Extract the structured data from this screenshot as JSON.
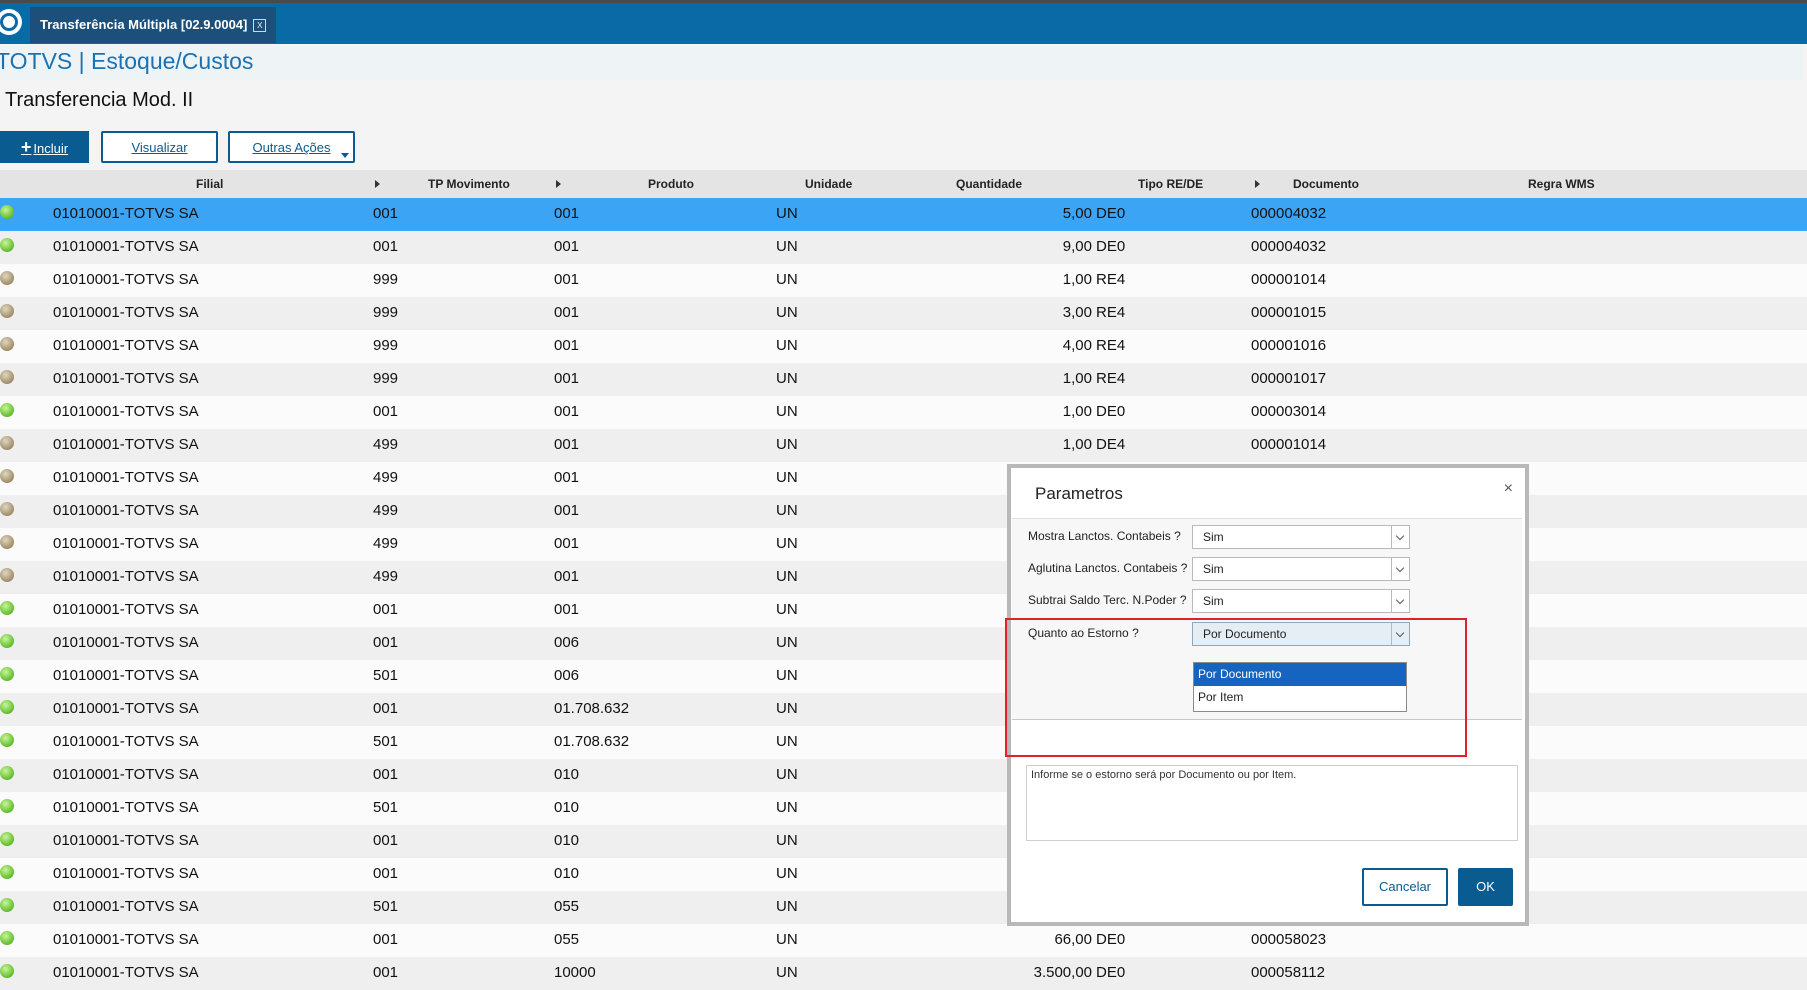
{
  "window": {
    "tab_title": "Transferência Múltipla [02.9.0004]",
    "tab_close": "x",
    "app_title": "TOTVS | Estoque/Custos",
    "page_title": "Transferencia Mod. II"
  },
  "toolbar": {
    "incluir": "Incluir",
    "visualizar": "Visualizar",
    "outras": "Outras Ações"
  },
  "grid": {
    "headers": {
      "filial": "Filial",
      "tp": "TP Movimento",
      "produto": "Produto",
      "unidade": "Unidade",
      "quantidade": "Quantidade",
      "tipo": "Tipo RE/DE",
      "documento": "Documento",
      "regra": "Regra WMS"
    },
    "rows": [
      {
        "status": "green",
        "filial": "01010001-TOTVS SA",
        "tp": "001",
        "produto": "001",
        "un": "UN",
        "qtd": "5,00",
        "tipo": "DE0",
        "doc": "000004032"
      },
      {
        "status": "green",
        "filial": "01010001-TOTVS SA",
        "tp": "001",
        "produto": "001",
        "un": "UN",
        "qtd": "9,00",
        "tipo": "DE0",
        "doc": "000004032"
      },
      {
        "status": "brown",
        "filial": "01010001-TOTVS SA",
        "tp": "999",
        "produto": "001",
        "un": "UN",
        "qtd": "1,00",
        "tipo": "RE4",
        "doc": "000001014"
      },
      {
        "status": "brown",
        "filial": "01010001-TOTVS SA",
        "tp": "999",
        "produto": "001",
        "un": "UN",
        "qtd": "3,00",
        "tipo": "RE4",
        "doc": "000001015"
      },
      {
        "status": "brown",
        "filial": "01010001-TOTVS SA",
        "tp": "999",
        "produto": "001",
        "un": "UN",
        "qtd": "4,00",
        "tipo": "RE4",
        "doc": "000001016"
      },
      {
        "status": "brown",
        "filial": "01010001-TOTVS SA",
        "tp": "999",
        "produto": "001",
        "un": "UN",
        "qtd": "1,00",
        "tipo": "RE4",
        "doc": "000001017"
      },
      {
        "status": "green",
        "filial": "01010001-TOTVS SA",
        "tp": "001",
        "produto": "001",
        "un": "UN",
        "qtd": "1,00",
        "tipo": "DE0",
        "doc": "000003014"
      },
      {
        "status": "brown",
        "filial": "01010001-TOTVS SA",
        "tp": "499",
        "produto": "001",
        "un": "UN",
        "qtd": "1,00",
        "tipo": "DE4",
        "doc": "000001014"
      },
      {
        "status": "brown",
        "filial": "01010001-TOTVS SA",
        "tp": "499",
        "produto": "001",
        "un": "UN",
        "qtd": "",
        "tipo": "",
        "doc": ""
      },
      {
        "status": "brown",
        "filial": "01010001-TOTVS SA",
        "tp": "499",
        "produto": "001",
        "un": "UN",
        "qtd": "",
        "tipo": "",
        "doc": ""
      },
      {
        "status": "brown",
        "filial": "01010001-TOTVS SA",
        "tp": "499",
        "produto": "001",
        "un": "UN",
        "qtd": "",
        "tipo": "",
        "doc": ""
      },
      {
        "status": "brown",
        "filial": "01010001-TOTVS SA",
        "tp": "499",
        "produto": "001",
        "un": "UN",
        "qtd": "",
        "tipo": "",
        "doc": ""
      },
      {
        "status": "green",
        "filial": "01010001-TOTVS SA",
        "tp": "001",
        "produto": "001",
        "un": "UN",
        "qtd": "",
        "tipo": "",
        "doc": ""
      },
      {
        "status": "green",
        "filial": "01010001-TOTVS SA",
        "tp": "001",
        "produto": "006",
        "un": "UN",
        "qtd": "",
        "tipo": "",
        "doc": ""
      },
      {
        "status": "green",
        "filial": "01010001-TOTVS SA",
        "tp": "501",
        "produto": "006",
        "un": "UN",
        "qtd": "",
        "tipo": "",
        "doc": ""
      },
      {
        "status": "green",
        "filial": "01010001-TOTVS SA",
        "tp": "001",
        "produto": "01.708.632",
        "un": "UN",
        "qtd": "",
        "tipo": "",
        "doc": ""
      },
      {
        "status": "green",
        "filial": "01010001-TOTVS SA",
        "tp": "501",
        "produto": "01.708.632",
        "un": "UN",
        "qtd": "",
        "tipo": "",
        "doc": ""
      },
      {
        "status": "green",
        "filial": "01010001-TOTVS SA",
        "tp": "001",
        "produto": "010",
        "un": "UN",
        "qtd": "",
        "tipo": "",
        "doc": ""
      },
      {
        "status": "green",
        "filial": "01010001-TOTVS SA",
        "tp": "501",
        "produto": "010",
        "un": "UN",
        "qtd": "",
        "tipo": "",
        "doc": ""
      },
      {
        "status": "green",
        "filial": "01010001-TOTVS SA",
        "tp": "001",
        "produto": "010",
        "un": "UN",
        "qtd": "",
        "tipo": "",
        "doc": ""
      },
      {
        "status": "green",
        "filial": "01010001-TOTVS SA",
        "tp": "001",
        "produto": "010",
        "un": "UN",
        "qtd": "",
        "tipo": "",
        "doc": ""
      },
      {
        "status": "green",
        "filial": "01010001-TOTVS SA",
        "tp": "501",
        "produto": "055",
        "un": "UN",
        "qtd": "",
        "tipo": "",
        "doc": ""
      },
      {
        "status": "green",
        "filial": "01010001-TOTVS SA",
        "tp": "001",
        "produto": "055",
        "un": "UN",
        "qtd": "66,00",
        "tipo": "DE0",
        "doc": "000058023"
      },
      {
        "status": "green",
        "filial": "01010001-TOTVS SA",
        "tp": "001",
        "produto": "10000",
        "un": "UN",
        "qtd": "3.500,00",
        "tipo": "DE0",
        "doc": "000058112"
      }
    ]
  },
  "modal": {
    "title": "Parametros",
    "close": "×",
    "params": [
      {
        "label": "Mostra Lanctos. Contabeis ?",
        "value": "Sim"
      },
      {
        "label": "Aglutina Lanctos. Contabeis ?",
        "value": "Sim"
      },
      {
        "label": "Subtrai Saldo Terc. N.Poder ?",
        "value": "Sim"
      },
      {
        "label": "Quanto ao Estorno ?",
        "value": "Por Documento"
      }
    ],
    "options": [
      "Por Documento",
      "Por Item"
    ],
    "help": "Informe se o estorno será por Documento ou por Item.",
    "cancel": "Cancelar",
    "ok": "OK"
  },
  "colors": {
    "header_bar": "#0a6aa6",
    "primary": "#0a5b8f",
    "selected_row": "#3ba4f4",
    "highlight_box": "#e0202a"
  }
}
